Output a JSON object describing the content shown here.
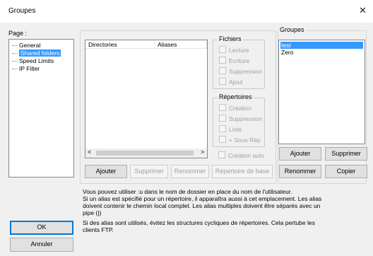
{
  "window": {
    "title": "Groupes",
    "close_glyph": "✕"
  },
  "page": {
    "label": "Page :",
    "tree": [
      {
        "label": "General",
        "selected": false
      },
      {
        "label": "Shared folders",
        "selected": true
      },
      {
        "label": "Speed Limits",
        "selected": false
      },
      {
        "label": "IP Filter",
        "selected": false
      }
    ]
  },
  "folders": {
    "columns": [
      "Directories",
      "Aliases"
    ],
    "buttons": {
      "add": "Ajouter",
      "remove": "Supprimer",
      "rename": "Renommer",
      "basedir": "Répertoire de base"
    },
    "scroll_left": "<",
    "scroll_right": ">"
  },
  "files": {
    "title": "Fichiers",
    "options": [
      "Lecture",
      "Ecriture",
      "Suppression",
      "Ajout"
    ]
  },
  "dirs": {
    "title": "Répertoires",
    "options": [
      "Création",
      "Suppression",
      "Liste",
      "+ Sous Rép"
    ]
  },
  "autocreate": "Création auto",
  "groups": {
    "title": "Groupes",
    "items": [
      {
        "label": "test",
        "selected": true
      },
      {
        "label": "Zero",
        "selected": false
      }
    ],
    "buttons": {
      "add": "Ajouter",
      "remove": "Supprimer",
      "rename": "Renommer",
      "copy": "Copier"
    }
  },
  "info": {
    "line1": "Vous pouvez utiliser :u dans le nom de dossier en place du nom de l'utilisateur.",
    "line2": "Si un alias est spécifié pour un répertoire, il apparaîtra aussi à cet emplacement. Les alias",
    "line3": "doivent contenir le chemin local complet. Les alias multiples doivent être séparés avec un",
    "line4": "pipe (|)",
    "line5": "Si des alias sont utilisés, évitez les structures cycliques de répertoires. Cela pertube les",
    "line6": "clients FTP."
  },
  "dialog": {
    "ok": "OK",
    "cancel": "Annuler"
  }
}
